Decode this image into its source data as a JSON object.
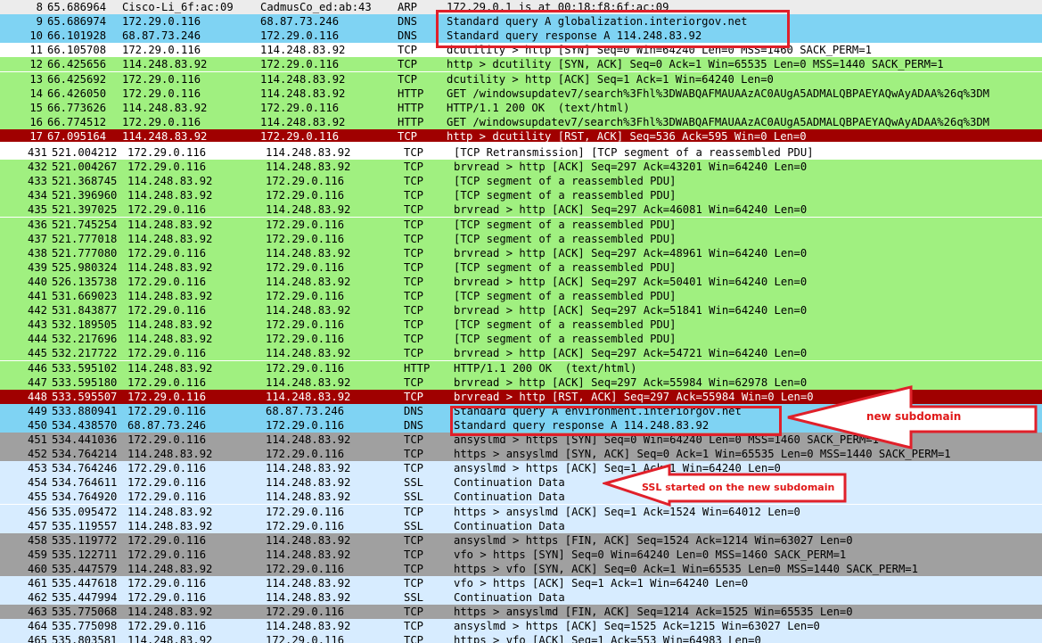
{
  "top_rows": [
    {
      "no": "8",
      "time": "65.686964",
      "src": "Cisco-Li_6f:ac:09",
      "dst": "CadmusCo_ed:ab:43",
      "proto": "ARP",
      "info": "172.29.0.1 is at 00:18:f8:6f:ac:09",
      "bg": "lgray"
    },
    {
      "no": "9",
      "time": "65.686974",
      "src": "172.29.0.116",
      "dst": "68.87.73.246",
      "proto": "DNS",
      "info": "Standard query A globalization.interiorgov.net",
      "bg": "blue"
    },
    {
      "no": "10",
      "time": "66.101928",
      "src": "68.87.73.246",
      "dst": "172.29.0.116",
      "proto": "DNS",
      "info": "Standard query response A 114.248.83.92",
      "bg": "blue"
    },
    {
      "no": "11",
      "time": "66.105708",
      "src": "172.29.0.116",
      "dst": "114.248.83.92",
      "proto": "TCP",
      "info": "dcutility > http [SYN] Seq=0 Win=64240 Len=0 MSS=1460 SACK_PERM=1",
      "bg": "white"
    },
    {
      "no": "12",
      "time": "66.425656",
      "src": "114.248.83.92",
      "dst": "172.29.0.116",
      "proto": "TCP",
      "info": "http > dcutility [SYN, ACK] Seq=0 Ack=1 Win=65535 Len=0 MSS=1440 SACK_PERM=1",
      "bg": "green"
    },
    {
      "no": "13",
      "time": "66.425692",
      "src": "172.29.0.116",
      "dst": "114.248.83.92",
      "proto": "TCP",
      "info": "dcutility > http [ACK] Seq=1 Ack=1 Win=64240 Len=0",
      "bg": "green"
    },
    {
      "no": "14",
      "time": "66.426050",
      "src": "172.29.0.116",
      "dst": "114.248.83.92",
      "proto": "HTTP",
      "info": "GET /windowsupdatev7/search%3Fhl%3DWABQAFMAUAAzAC0AUgA5ADMALQBPAEYAQwAyADAA%26q%3DM",
      "bg": "green"
    },
    {
      "no": "15",
      "time": "66.773626",
      "src": "114.248.83.92",
      "dst": "172.29.0.116",
      "proto": "HTTP",
      "info": "HTTP/1.1 200 OK  (text/html)",
      "bg": "green"
    },
    {
      "no": "16",
      "time": "66.774512",
      "src": "172.29.0.116",
      "dst": "114.248.83.92",
      "proto": "HTTP",
      "info": "GET /windowsupdatev7/search%3Fhl%3DWABQAFMAUAAzAC0AUgA5ADMALQBPAEYAQwAyADAA%26q%3DM",
      "bg": "green"
    },
    {
      "no": "17",
      "time": "67.095164",
      "src": "114.248.83.92",
      "dst": "172.29.0.116",
      "proto": "TCP",
      "info": "http > dcutility [RST, ACK] Seq=536 Ack=595 Win=0 Len=0",
      "bg": "red"
    }
  ],
  "bottom_rows": [
    {
      "no": "431",
      "time": "521.004212",
      "src": "172.29.0.116",
      "dst": "114.248.83.92",
      "proto": "TCP",
      "info": "[TCP Retransmission] [TCP segment of a reassembled PDU]",
      "bg": "white"
    },
    {
      "no": "432",
      "time": "521.004267",
      "src": "172.29.0.116",
      "dst": "114.248.83.92",
      "proto": "TCP",
      "info": "brvread > http [ACK] Seq=297 Ack=43201 Win=64240 Len=0",
      "bg": "green"
    },
    {
      "no": "433",
      "time": "521.368745",
      "src": "114.248.83.92",
      "dst": "172.29.0.116",
      "proto": "TCP",
      "info": "[TCP segment of a reassembled PDU]",
      "bg": "green"
    },
    {
      "no": "434",
      "time": "521.396960",
      "src": "114.248.83.92",
      "dst": "172.29.0.116",
      "proto": "TCP",
      "info": "[TCP segment of a reassembled PDU]",
      "bg": "green"
    },
    {
      "no": "435",
      "time": "521.397025",
      "src": "172.29.0.116",
      "dst": "114.248.83.92",
      "proto": "TCP",
      "info": "brvread > http [ACK] Seq=297 Ack=46081 Win=64240 Len=0",
      "bg": "green"
    },
    {
      "no": "436",
      "time": "521.745254",
      "src": "114.248.83.92",
      "dst": "172.29.0.116",
      "proto": "TCP",
      "info": "[TCP segment of a reassembled PDU]",
      "bg": "green"
    },
    {
      "no": "437",
      "time": "521.777018",
      "src": "114.248.83.92",
      "dst": "172.29.0.116",
      "proto": "TCP",
      "info": "[TCP segment of a reassembled PDU]",
      "bg": "green"
    },
    {
      "no": "438",
      "time": "521.777080",
      "src": "172.29.0.116",
      "dst": "114.248.83.92",
      "proto": "TCP",
      "info": "brvread > http [ACK] Seq=297 Ack=48961 Win=64240 Len=0",
      "bg": "green"
    },
    {
      "no": "439",
      "time": "525.980324",
      "src": "114.248.83.92",
      "dst": "172.29.0.116",
      "proto": "TCP",
      "info": "[TCP segment of a reassembled PDU]",
      "bg": "green"
    },
    {
      "no": "440",
      "time": "526.135738",
      "src": "172.29.0.116",
      "dst": "114.248.83.92",
      "proto": "TCP",
      "info": "brvread > http [ACK] Seq=297 Ack=50401 Win=64240 Len=0",
      "bg": "green"
    },
    {
      "no": "441",
      "time": "531.669023",
      "src": "114.248.83.92",
      "dst": "172.29.0.116",
      "proto": "TCP",
      "info": "[TCP segment of a reassembled PDU]",
      "bg": "green"
    },
    {
      "no": "442",
      "time": "531.843877",
      "src": "172.29.0.116",
      "dst": "114.248.83.92",
      "proto": "TCP",
      "info": "brvread > http [ACK] Seq=297 Ack=51841 Win=64240 Len=0",
      "bg": "green"
    },
    {
      "no": "443",
      "time": "532.189505",
      "src": "114.248.83.92",
      "dst": "172.29.0.116",
      "proto": "TCP",
      "info": "[TCP segment of a reassembled PDU]",
      "bg": "green"
    },
    {
      "no": "444",
      "time": "532.217696",
      "src": "114.248.83.92",
      "dst": "172.29.0.116",
      "proto": "TCP",
      "info": "[TCP segment of a reassembled PDU]",
      "bg": "green"
    },
    {
      "no": "445",
      "time": "532.217722",
      "src": "172.29.0.116",
      "dst": "114.248.83.92",
      "proto": "TCP",
      "info": "brvread > http [ACK] Seq=297 Ack=54721 Win=64240 Len=0",
      "bg": "green"
    },
    {
      "no": "446",
      "time": "533.595102",
      "src": "114.248.83.92",
      "dst": "172.29.0.116",
      "proto": "HTTP",
      "info": "HTTP/1.1 200 OK  (text/html)",
      "bg": "green"
    },
    {
      "no": "447",
      "time": "533.595180",
      "src": "172.29.0.116",
      "dst": "114.248.83.92",
      "proto": "TCP",
      "info": "brvread > http [ACK] Seq=297 Ack=55984 Win=62978 Len=0",
      "bg": "green"
    },
    {
      "no": "448",
      "time": "533.595507",
      "src": "172.29.0.116",
      "dst": "114.248.83.92",
      "proto": "TCP",
      "info": "brvread > http [RST, ACK] Seq=297 Ack=55984 Win=0 Len=0",
      "bg": "red"
    },
    {
      "no": "449",
      "time": "533.880941",
      "src": "172.29.0.116",
      "dst": "68.87.73.246",
      "proto": "DNS",
      "info": "Standard query A environment.interiorgov.net",
      "bg": "blue"
    },
    {
      "no": "450",
      "time": "534.438570",
      "src": "68.87.73.246",
      "dst": "172.29.0.116",
      "proto": "DNS",
      "info": "Standard query response A 114.248.83.92",
      "bg": "blue"
    },
    {
      "no": "451",
      "time": "534.441036",
      "src": "172.29.0.116",
      "dst": "114.248.83.92",
      "proto": "TCP",
      "info": "ansyslmd > https [SYN] Seq=0 Win=64240 Len=0 MSS=1460 SACK_PERM=1",
      "bg": "gray"
    },
    {
      "no": "452",
      "time": "534.764214",
      "src": "114.248.83.92",
      "dst": "172.29.0.116",
      "proto": "TCP",
      "info": "https > ansyslmd [SYN, ACK] Seq=0 Ack=1 Win=65535 Len=0 MSS=1440 SACK_PERM=1",
      "bg": "gray"
    },
    {
      "no": "453",
      "time": "534.764246",
      "src": "172.29.0.116",
      "dst": "114.248.83.92",
      "proto": "TCP",
      "info": "ansyslmd > https [ACK] Seq=1 Ack=1 Win=64240 Len=0",
      "bg": "lblue"
    },
    {
      "no": "454",
      "time": "534.764611",
      "src": "172.29.0.116",
      "dst": "114.248.83.92",
      "proto": "SSL",
      "info": "Continuation Data",
      "bg": "lblue"
    },
    {
      "no": "455",
      "time": "534.764920",
      "src": "172.29.0.116",
      "dst": "114.248.83.92",
      "proto": "SSL",
      "info": "Continuation Data",
      "bg": "lblue"
    },
    {
      "no": "456",
      "time": "535.095472",
      "src": "114.248.83.92",
      "dst": "172.29.0.116",
      "proto": "TCP",
      "info": "https > ansyslmd [ACK] Seq=1 Ack=1524 Win=64012 Len=0",
      "bg": "lblue"
    },
    {
      "no": "457",
      "time": "535.119557",
      "src": "114.248.83.92",
      "dst": "172.29.0.116",
      "proto": "SSL",
      "info": "Continuation Data",
      "bg": "lblue"
    },
    {
      "no": "458",
      "time": "535.119772",
      "src": "172.29.0.116",
      "dst": "114.248.83.92",
      "proto": "TCP",
      "info": "ansyslmd > https [FIN, ACK] Seq=1524 Ack=1214 Win=63027 Len=0",
      "bg": "gray"
    },
    {
      "no": "459",
      "time": "535.122711",
      "src": "172.29.0.116",
      "dst": "114.248.83.92",
      "proto": "TCP",
      "info": "vfo > https [SYN] Seq=0 Win=64240 Len=0 MSS=1460 SACK_PERM=1",
      "bg": "gray"
    },
    {
      "no": "460",
      "time": "535.447579",
      "src": "114.248.83.92",
      "dst": "172.29.0.116",
      "proto": "TCP",
      "info": "https > vfo [SYN, ACK] Seq=0 Ack=1 Win=65535 Len=0 MSS=1440 SACK_PERM=1",
      "bg": "gray"
    },
    {
      "no": "461",
      "time": "535.447618",
      "src": "172.29.0.116",
      "dst": "114.248.83.92",
      "proto": "TCP",
      "info": "vfo > https [ACK] Seq=1 Ack=1 Win=64240 Len=0",
      "bg": "lblue"
    },
    {
      "no": "462",
      "time": "535.447994",
      "src": "172.29.0.116",
      "dst": "114.248.83.92",
      "proto": "SSL",
      "info": "Continuation Data",
      "bg": "lblue"
    },
    {
      "no": "463",
      "time": "535.775068",
      "src": "114.248.83.92",
      "dst": "172.29.0.116",
      "proto": "TCP",
      "info": "https > ansyslmd [FIN, ACK] Seq=1214 Ack=1525 Win=65535 Len=0",
      "bg": "gray"
    },
    {
      "no": "464",
      "time": "535.775098",
      "src": "172.29.0.116",
      "dst": "114.248.83.92",
      "proto": "TCP",
      "info": "ansyslmd > https [ACK] Seq=1525 Ack=1215 Win=63027 Len=0",
      "bg": "lblue"
    },
    {
      "no": "465",
      "time": "535.803581",
      "src": "114.248.83.92",
      "dst": "172.29.0.116",
      "proto": "TCP",
      "info": "https > vfo [ACK] Seq=1 Ack=553 Win=64983 Len=0",
      "bg": "lblue"
    }
  ],
  "annotations": {
    "new_subdomain": "new  subdomain",
    "ssl_started": "SSL started on the new  subdomain"
  },
  "colors": {
    "annotation_red": "#e0202a",
    "row_green": "#a0f080",
    "row_blue": "#7fd3f3",
    "row_red": "#a00000",
    "row_gray": "#a0a0a0",
    "row_lightblue": "#d7ecff"
  }
}
